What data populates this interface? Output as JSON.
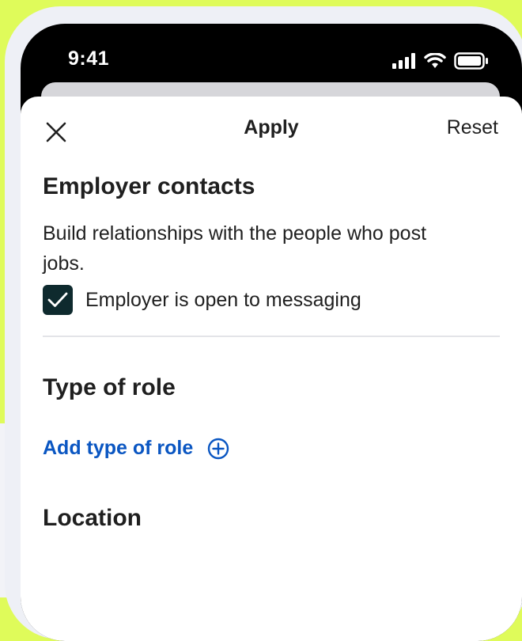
{
  "status_bar": {
    "time": "9:41",
    "icons": [
      "signal-icon",
      "wifi-icon",
      "battery-icon"
    ]
  },
  "header": {
    "close_icon": "close-icon",
    "apply_label": "Apply",
    "reset_label": "Reset"
  },
  "employer_contacts": {
    "title": "Employer contacts",
    "description": "Build relationships with the people who post jobs.",
    "checkbox_label": "Employer is open to messaging",
    "checked": true
  },
  "type_of_role": {
    "title": "Type of role",
    "add_label": "Add type of role",
    "add_icon": "plus-circle-icon"
  },
  "location": {
    "title": "Location"
  },
  "colors": {
    "background": "#dffb5a",
    "link": "#0a56c2",
    "checkbox": "#0e2a2e",
    "text": "#1f1f1f"
  }
}
